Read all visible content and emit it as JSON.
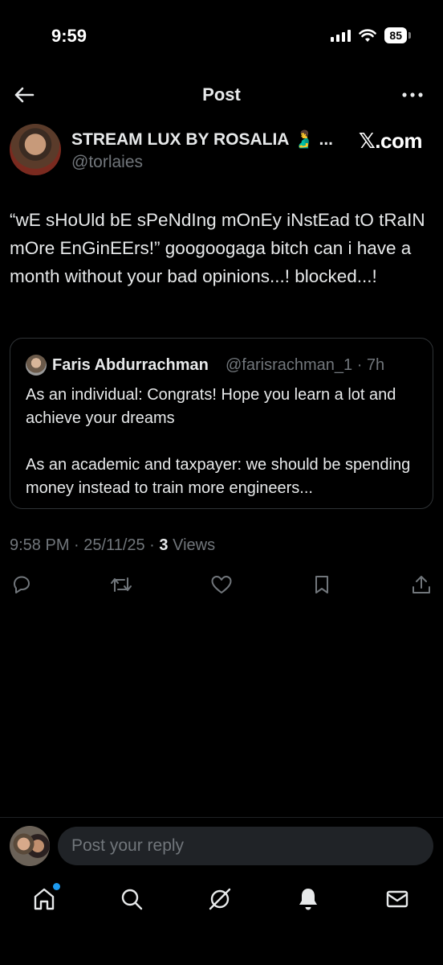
{
  "status": {
    "time": "9:59",
    "battery": "85"
  },
  "header": {
    "title": "Post"
  },
  "post": {
    "author_name": "STREAM LUX BY ROSALIA 🫃 ...",
    "author_handle": "@torlaies",
    "brand": "𝕏.com",
    "text": "“wE sHoUld bE sPeNdIng mOnEy iNstEad tO tRaIN mOre EnGinEErs!” googoogaga bitch can i have a month without your bad opinions...! blocked...!",
    "quote": {
      "author_name": "Faris Abdurrachman",
      "author_handle": "@farisrachman_1 · 7h",
      "paragraph1": "As an individual: Congrats! Hope you learn a lot and achieve your dreams",
      "paragraph2": "As an academic and taxpayer: we should be spending money instead to train more engineers..."
    },
    "timestamp": "9:58 PM · 25/11/25 · ",
    "views_count": "3",
    "views_label": " Views"
  },
  "reply": {
    "placeholder": "Post your reply"
  },
  "icons": {
    "back": "arrow-left",
    "more": "more-horizontal",
    "reply": "speech-bubble",
    "repost": "repost-arrows",
    "like": "heart",
    "bookmark": "bookmark",
    "share": "share-upload",
    "home": "home",
    "search": "magnifier",
    "grok": "grok-slash-circle",
    "notifications": "bell",
    "messages": "envelope"
  },
  "colors": {
    "background": "#000000",
    "text": "#e7e9ea",
    "muted": "#71767b",
    "accent": "#1d9bf0",
    "border": "#2f3336"
  }
}
